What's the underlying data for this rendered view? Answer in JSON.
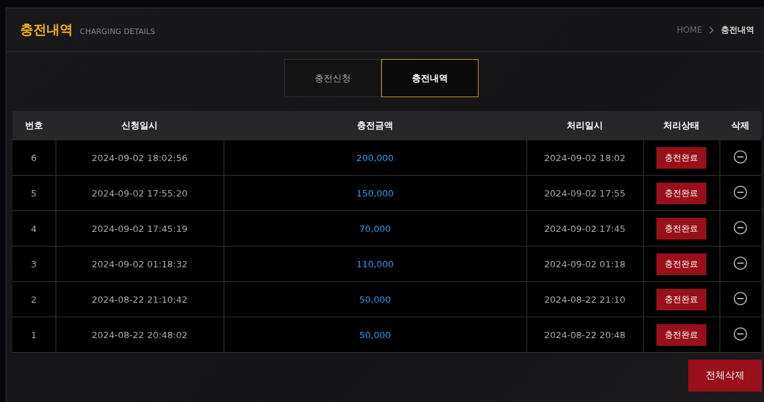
{
  "header": {
    "title": "충전내역",
    "subtitle": "CHARGING DETAILS",
    "breadcrumb": [
      {
        "label": "HOME",
        "current": false
      },
      {
        "label": "충전내역",
        "current": true
      }
    ]
  },
  "tabs": [
    {
      "label": "충전신청",
      "selected": false
    },
    {
      "label": "충전내역",
      "selected": true
    }
  ],
  "table": {
    "columns": [
      "번호",
      "신청일시",
      "충전금액",
      "처리일시",
      "처리상태",
      "삭제"
    ],
    "rows": [
      {
        "no": "6",
        "requested": "2024-09-02 18:02:56",
        "amount": "200,000",
        "processed": "2024-09-02 18:02",
        "status": "충전완료"
      },
      {
        "no": "5",
        "requested": "2024-09-02 17:55:20",
        "amount": "150,000",
        "processed": "2024-09-02 17:55",
        "status": "충전완료"
      },
      {
        "no": "4",
        "requested": "2024-09-02 17:45:19",
        "amount": "70,000",
        "processed": "2024-09-02 17:45",
        "status": "충전완료"
      },
      {
        "no": "3",
        "requested": "2024-09-02 01:18:32",
        "amount": "110,000",
        "processed": "2024-09-02 01:18",
        "status": "충전완료"
      },
      {
        "no": "2",
        "requested": "2024-08-22 21:10:42",
        "amount": "50,000",
        "processed": "2024-08-22 21:10",
        "status": "충전완료"
      },
      {
        "no": "1",
        "requested": "2024-08-22 20:48:02",
        "amount": "50,000",
        "processed": "2024-08-22 20:48",
        "status": "충전완료"
      }
    ]
  },
  "delete_all_button": "전체삭제"
}
